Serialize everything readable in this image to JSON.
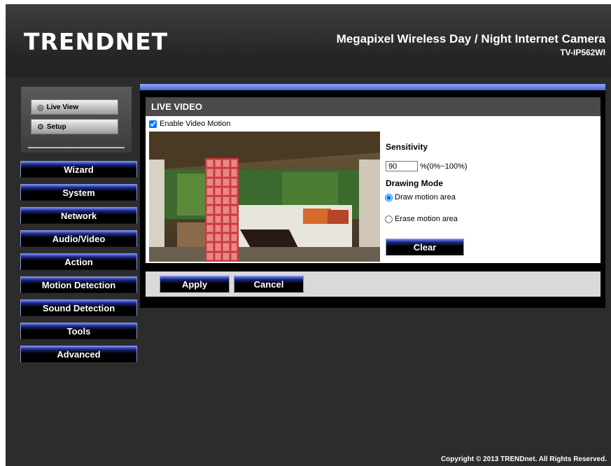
{
  "header": {
    "logo": "TRENDNET",
    "product_title": "Megapixel Wireless Day / Night Internet Camera",
    "product_model": "TV-IP562WI"
  },
  "top_menu": {
    "live_view": "Live View",
    "setup": "Setup"
  },
  "nav": {
    "items": [
      {
        "label": "Wizard"
      },
      {
        "label": "System"
      },
      {
        "label": "Network"
      },
      {
        "label": "Audio/Video"
      },
      {
        "label": "Action"
      },
      {
        "label": "Motion Detection"
      },
      {
        "label": "Sound Detection"
      },
      {
        "label": "Tools"
      },
      {
        "label": "Advanced"
      }
    ]
  },
  "panel": {
    "title": "LIVE VIDEO",
    "enable_label": "Enable Video Motion",
    "enable_checked": true,
    "sensitivity_label": "Sensitivity",
    "sensitivity_value": "90",
    "sensitivity_range": "%(0%~100%)",
    "drawing_mode_label": "Drawing Mode",
    "draw_label": "Draw motion area",
    "erase_label": "Erase motion area",
    "clear_label": "Clear",
    "apply_label": "Apply",
    "cancel_label": "Cancel"
  },
  "footer": "Copyright © 2013 TRENDnet. All Rights Reserved.",
  "colors": {
    "background": "#2c2c2c",
    "accent_blue": "#6f86ff",
    "header_bar": "#4a4a4a"
  },
  "icons": [
    "live-view-icon",
    "setup-icon"
  ]
}
